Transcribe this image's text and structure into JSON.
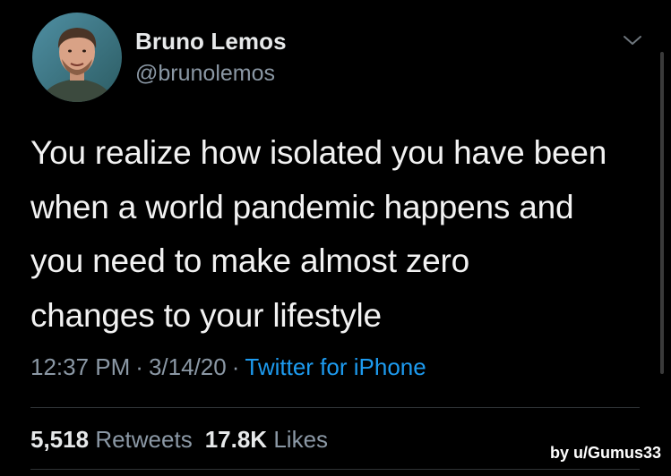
{
  "user": {
    "display_name": "Bruno Lemos",
    "handle": "@brunolemos"
  },
  "tweet": {
    "text": "You realize how isolated you have been\nwhen a world pandemic happens and\nyou need to make  almost zero\nchanges to your lifestyle",
    "time": "12:37 PM",
    "date": "3/14/20",
    "source": "Twitter for iPhone",
    "separator": "·"
  },
  "stats": {
    "retweets_count": "5,518",
    "retweets_label": "Retweets",
    "likes_count": "17.8K",
    "likes_label": "Likes"
  },
  "watermark": "by u/Gumus33",
  "icons": {
    "menu": "chevron-down-icon",
    "avatar": "avatar"
  },
  "colors": {
    "background": "#000000",
    "link": "#1d9bf0",
    "secondary_text": "#8b98a5",
    "primary_text": "#e7e9ea"
  }
}
